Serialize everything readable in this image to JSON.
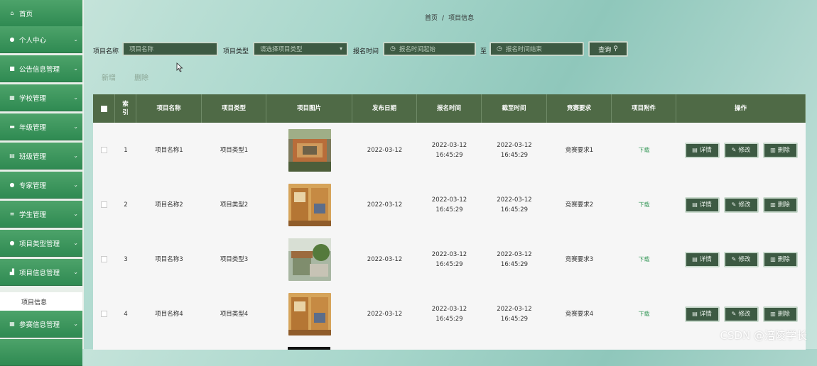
{
  "sidebar": {
    "items": [
      {
        "label": "首页",
        "icon": "home-icon",
        "glyph": "⌂",
        "chevron": false
      },
      {
        "label": "个人中心",
        "icon": "user-icon",
        "glyph": "●",
        "chevron": true
      },
      {
        "label": "公告信息管理",
        "icon": "briefcase-icon",
        "glyph": "■",
        "chevron": true
      },
      {
        "label": "学校管理",
        "icon": "grid-icon",
        "glyph": "▦",
        "chevron": true
      },
      {
        "label": "年级管理",
        "icon": "chat-icon",
        "glyph": "▬",
        "chevron": true
      },
      {
        "label": "班级管理",
        "icon": "table-icon",
        "glyph": "▤",
        "chevron": true
      },
      {
        "label": "专家管理",
        "icon": "user-icon",
        "glyph": "●",
        "chevron": true
      },
      {
        "label": "学生管理",
        "icon": "list-icon",
        "glyph": "≡",
        "chevron": true
      },
      {
        "label": "项目类型管理",
        "icon": "user-icon",
        "glyph": "●",
        "chevron": true
      },
      {
        "label": "项目信息管理",
        "icon": "chart-icon",
        "glyph": "▟",
        "chevron": true
      },
      {
        "label": "参赛信息管理",
        "icon": "grid-icon",
        "glyph": "▦",
        "chevron": true
      }
    ],
    "sub_item": "项目信息"
  },
  "breadcrumb": {
    "home": "首页",
    "sep": "/",
    "current": "项目信息"
  },
  "search": {
    "name_label": "项目名称",
    "name_placeholder": "项目名称",
    "type_label": "项目类型",
    "type_placeholder": "请选择项目类型",
    "time_label": "报名时间",
    "time_start_placeholder": "报名时间起始",
    "to_label": "至",
    "time_end_placeholder": "报名时间结束",
    "button": "查询"
  },
  "actions": {
    "add": "新增",
    "delete": "删除"
  },
  "table": {
    "headers": [
      "",
      "索引",
      "项目名称",
      "项目类型",
      "项目图片",
      "发布日期",
      "报名时间",
      "截至时间",
      "竞赛要求",
      "项目附件",
      "操作"
    ],
    "rows": [
      {
        "index": "1",
        "name": "项目名称1",
        "type": "项目类型1",
        "date": "2022-03-12",
        "start": "2022-03-12 16:45:29",
        "end": "2022-03-12 16:45:29",
        "req": "竞赛要求1",
        "file": "下载"
      },
      {
        "index": "2",
        "name": "项目名称2",
        "type": "项目类型2",
        "date": "2022-03-12",
        "start": "2022-03-12 16:45:29",
        "end": "2022-03-12 16:45:29",
        "req": "竞赛要求2",
        "file": "下载"
      },
      {
        "index": "3",
        "name": "项目名称3",
        "type": "项目类型3",
        "date": "2022-03-12",
        "start": "2022-03-12 16:45:29",
        "end": "2022-03-12 16:45:29",
        "req": "竞赛要求3",
        "file": "下载"
      },
      {
        "index": "4",
        "name": "项目名称4",
        "type": "项目类型4",
        "date": "2022-03-12",
        "start": "2022-03-12 16:45:29",
        "end": "2022-03-12 16:45:29",
        "req": "竞赛要求4",
        "file": "下载"
      }
    ],
    "buttons": {
      "detail": "详情",
      "edit": "修改",
      "delete": "删除"
    }
  },
  "watermark": "CSDN @涪陵学长",
  "colors": {
    "sidebar": "#2f8a52",
    "header": "#4f6a46",
    "button": "#3d5a43",
    "link": "#3c9b5d"
  }
}
